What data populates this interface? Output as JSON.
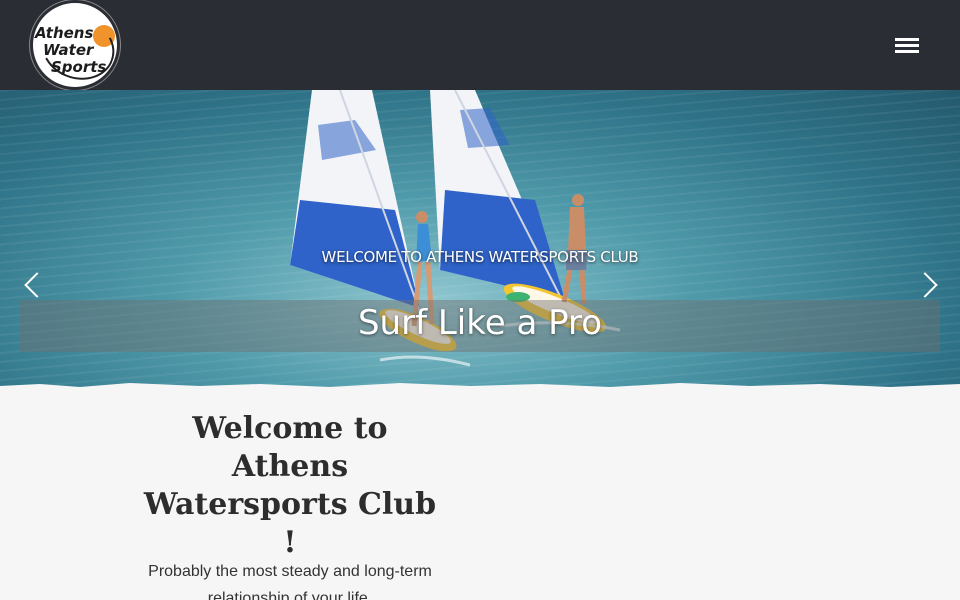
{
  "header": {
    "logo": {
      "text_lines": [
        "Athens",
        "Water",
        "Sports"
      ],
      "icon": "athens-watersports-logo"
    },
    "menu": {
      "icon": "hamburger-menu-icon"
    },
    "background_color": "#2b2d35"
  },
  "hero": {
    "subtitle": "WELCOME TO ATHENS WATERSPORTS CLUB",
    "title": "Surf Like a Pro",
    "prev_icon": "chevron-left-icon",
    "next_icon": "chevron-right-icon",
    "image": "two windsurfers on paddle boards with blue sails on the sea"
  },
  "content": {
    "welcome_heading": "Welcome to Athens Watersports Club !",
    "intro_text": "Probably the most steady and long-term relationship of your life."
  },
  "colors": {
    "accent_orange": "#f0932b",
    "page_background": "#f6f6f6"
  }
}
